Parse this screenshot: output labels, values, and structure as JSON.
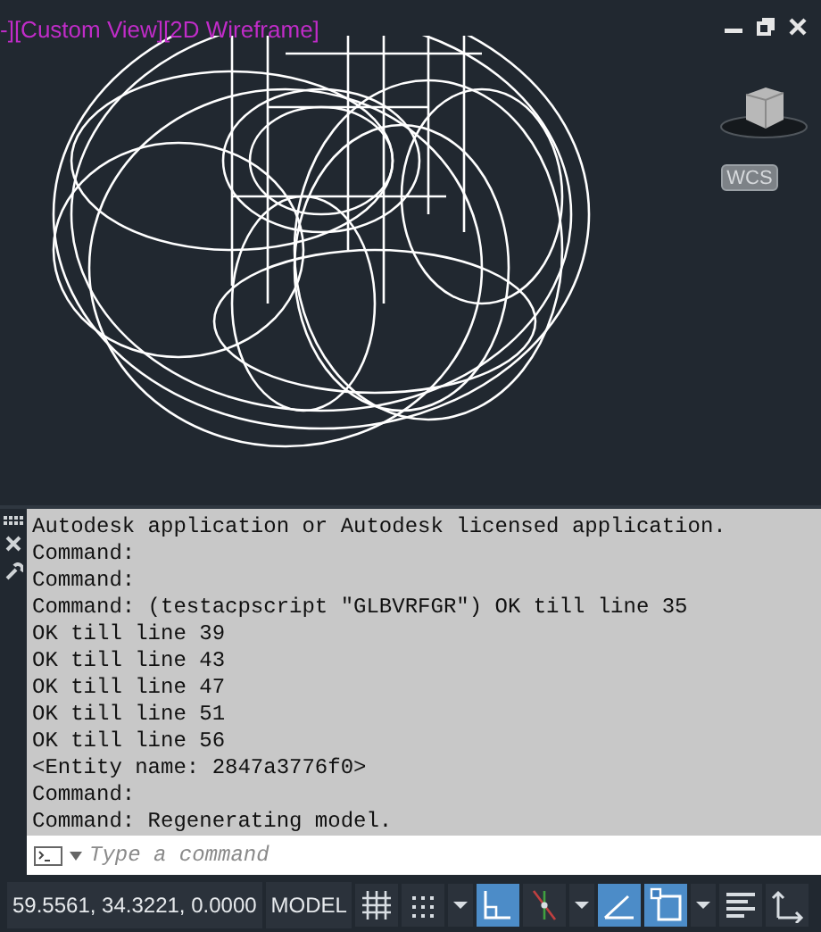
{
  "viewport": {
    "label": "-][Custom View][2D Wireframe]",
    "wcs": "WCS"
  },
  "command_window": {
    "history": [
      "Autodesk application or Autodesk licensed application.",
      "Command:",
      "Command:",
      "Command: (testacpscript \"GLBVRFGR\") OK till line 35",
      "OK till line 39",
      "OK till line 43",
      "OK till line 47",
      "OK till line 51",
      "OK till line 56",
      "<Entity name: 2847a3776f0>",
      "Command:",
      "Command: Regenerating model."
    ],
    "input": {
      "placeholder": "Type a command"
    }
  },
  "status_bar": {
    "coordinates": "59.5561, 34.3221, 0.0000",
    "space": "MODEL",
    "toggles": [
      {
        "kind": "grid",
        "on": false
      },
      {
        "kind": "snap",
        "on": false
      },
      {
        "kind": "caret"
      },
      {
        "kind": "ortho",
        "on": true
      },
      {
        "kind": "polar",
        "on": false
      },
      {
        "kind": "caret"
      },
      {
        "kind": "iso",
        "on": true
      },
      {
        "kind": "osnap",
        "on": true
      },
      {
        "kind": "caret"
      },
      {
        "kind": "lineweight",
        "on": false
      },
      {
        "kind": "ucs",
        "on": false
      }
    ]
  }
}
